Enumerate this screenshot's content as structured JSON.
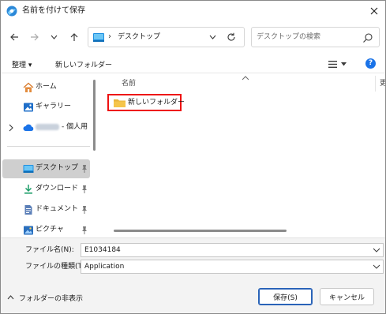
{
  "window": {
    "title": "名前を付けて保存",
    "icon": "app-icon"
  },
  "navigation": {
    "address_segment": "デスクトップ",
    "address_separator": "›",
    "search_placeholder": "デスクトップの検索"
  },
  "toolbar": {
    "organize_label": "整理 ▾",
    "new_folder_label": "新しいフォルダー"
  },
  "sidebar": {
    "items": [
      {
        "label": "ホーム",
        "icon": "home-icon",
        "pinned": false
      },
      {
        "label": "ギャラリー",
        "icon": "gallery-icon",
        "pinned": false
      },
      {
        "label": "- 個人用",
        "icon": "onedrive-cloud-icon",
        "pinned": false
      },
      {
        "label": "デスクトップ",
        "icon": "desktop-icon",
        "pinned": true
      },
      {
        "label": "ダウンロード",
        "icon": "download-icon",
        "pinned": true
      },
      {
        "label": "ドキュメント",
        "icon": "document-icon",
        "pinned": true
      },
      {
        "label": "ピクチャ",
        "icon": "pictures-icon",
        "pinned": true
      }
    ]
  },
  "file_list": {
    "columns": [
      "名前",
      "更"
    ],
    "items": [
      {
        "name": "新しいフォルダー",
        "icon": "folder-icon"
      }
    ]
  },
  "form": {
    "filename_label": "ファイル名(N):",
    "filename_value": "E1034184",
    "filetype_label": "ファイルの種類(T):",
    "filetype_value": "Application"
  },
  "footer": {
    "hide_folders_label": "フォルダーの非表示",
    "save_label": "保存(S)",
    "cancel_label": "キャンセル"
  },
  "colors": {
    "accent": "#1a73e8",
    "highlight_border": "#e11111",
    "selected_nav": "#cfcfcf",
    "folder": "#f5c54a"
  }
}
